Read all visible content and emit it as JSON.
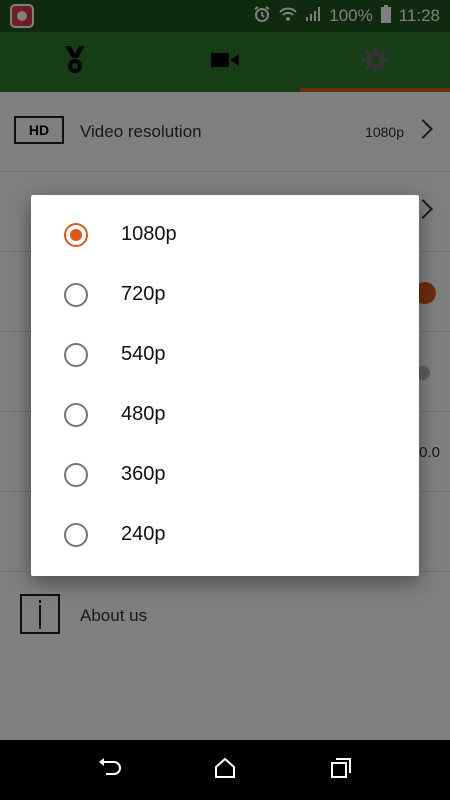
{
  "status": {
    "battery": "100%",
    "time": "11:28"
  },
  "tabs": [
    {
      "name": "achievements",
      "icon": "medal-icon"
    },
    {
      "name": "record",
      "icon": "video-camera-icon"
    },
    {
      "name": "settings",
      "icon": "gear-icon",
      "active": true
    }
  ],
  "settings": {
    "video_resolution": {
      "label": "Video resolution",
      "value": "1080p",
      "icon_text": "HD"
    },
    "partial_value": "0.0",
    "about": {
      "label": "About us"
    }
  },
  "dialog": {
    "options": [
      "1080p",
      "720p",
      "540p",
      "480p",
      "360p",
      "240p"
    ],
    "selected": "1080p"
  },
  "colors": {
    "status_bar": "#1f561d",
    "toolbar": "#2f7a2c",
    "accent": "#e0561b"
  }
}
